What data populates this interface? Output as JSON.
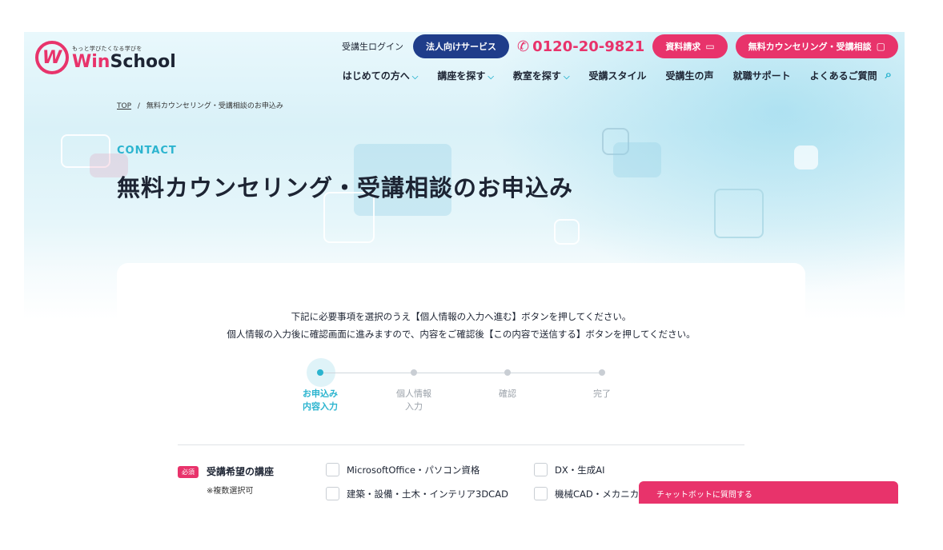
{
  "header": {
    "logo_tagline": "もっと学びたくなる学びを",
    "logo_win": "Win",
    "logo_school": "School",
    "login_label": "受講生ログイン",
    "corporate_label": "法人向けサービス",
    "phone": "0120-20-9821",
    "brochure_label": "資料請求",
    "counseling_label": "無料カウンセリング・受講相談"
  },
  "nav": {
    "items": [
      {
        "label": "はじめての方へ"
      },
      {
        "label": "講座を探す"
      },
      {
        "label": "教室を探す"
      },
      {
        "label": "受講スタイル"
      },
      {
        "label": "受講生の声"
      },
      {
        "label": "就職サポート"
      },
      {
        "label": "よくあるご質問"
      }
    ]
  },
  "breadcrumb": {
    "home": "TOP",
    "separator": "/",
    "current": "無料カウンセリング・受講相談のお申込み"
  },
  "hero": {
    "eyebrow": "CONTACT",
    "title": "無料カウンセリング・受講相談のお申込み"
  },
  "form": {
    "intro_line1": "下記に必要事項を選択のうえ【個人情報の入力へ進む】ボタンを押してください。",
    "intro_line2": "個人情報の入力後に確認画面に進みますので、内容をご確認後【この内容で送信する】ボタンを押してください。",
    "steps": [
      {
        "line1": "お申込み",
        "line2": "内容入力",
        "active": true
      },
      {
        "line1": "個人情報",
        "line2": "入力",
        "active": false
      },
      {
        "line1": "確認",
        "line2": "",
        "active": false
      },
      {
        "line1": "完了",
        "line2": "",
        "active": false
      }
    ],
    "required_badge": "必須",
    "course_label": "受講希望の講座",
    "course_note": "※複数選択可",
    "options": [
      "MicrosoftOffice・パソコン資格",
      "DX・生成AI",
      "建築・設備・土木・インテリア3DCAD",
      "機械CAD・メカニカ"
    ]
  },
  "chatbot": {
    "label": "チャットボットに質問する"
  },
  "colors": {
    "accent_pink": "#e8336b",
    "navy": "#1f3d8a",
    "cyan": "#2bb4cf"
  }
}
